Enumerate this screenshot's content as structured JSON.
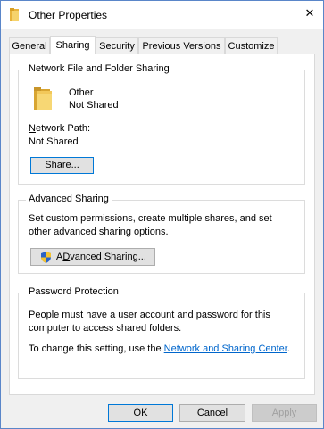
{
  "window": {
    "title": "Other Properties",
    "close_glyph": "✕",
    "folder_icon": "folder-icon"
  },
  "tabs": [
    {
      "label": "General",
      "active": false
    },
    {
      "label": "Sharing",
      "active": true
    },
    {
      "label": "Security",
      "active": false
    },
    {
      "label": "Previous Versions",
      "active": false
    },
    {
      "label": "Customize",
      "active": false
    }
  ],
  "network_sharing": {
    "group_title": "Network File and Folder Sharing",
    "folder_name": "Other",
    "folder_status": "Not Shared",
    "network_path_label_accel": "N",
    "network_path_label_rest": "etwork Path:",
    "network_path_value": "Not Shared",
    "share_button_accel": "S",
    "share_button_rest": "hare..."
  },
  "advanced_sharing": {
    "group_title": "Advanced Sharing",
    "description": "Set custom permissions, create multiple shares, and set other advanced sharing options.",
    "button_accel": "D",
    "button_pre": "A",
    "button_rest": "vanced Sharing...",
    "button_prefix_hidden": "",
    "shield_icon": "uac-shield-icon"
  },
  "password_protection": {
    "group_title": "Password Protection",
    "description": "People must have a user account and password for this computer to access shared folders.",
    "change_text": "To change this setting, use the",
    "link_text": "Network and Sharing Center",
    "trailing": "."
  },
  "footer": {
    "ok_label": "OK",
    "cancel_label": "Cancel",
    "apply_label_accel": "A",
    "apply_label_rest": "pply"
  },
  "colors": {
    "link": "#0066cc",
    "default_button_border": "#0078d7",
    "window_border": "#5a86c9"
  }
}
